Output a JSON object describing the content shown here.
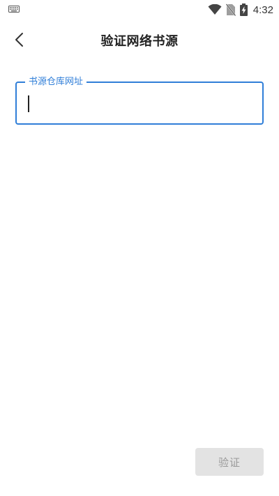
{
  "status_bar": {
    "time": "4:32",
    "icons": [
      "keyboard-icon",
      "wifi-icon",
      "no-sim-icon",
      "battery-charging-icon"
    ]
  },
  "app_bar": {
    "title": "验证网络书源",
    "back_icon": "chevron-left-icon"
  },
  "form": {
    "url_field": {
      "label": "书源仓库网址",
      "value": ""
    }
  },
  "actions": {
    "verify_label": "验证"
  },
  "colors": {
    "accent": "#2f7ed8",
    "button_bg": "#e3e3e3",
    "button_text": "#9a9a9a",
    "title_text": "#222222"
  }
}
